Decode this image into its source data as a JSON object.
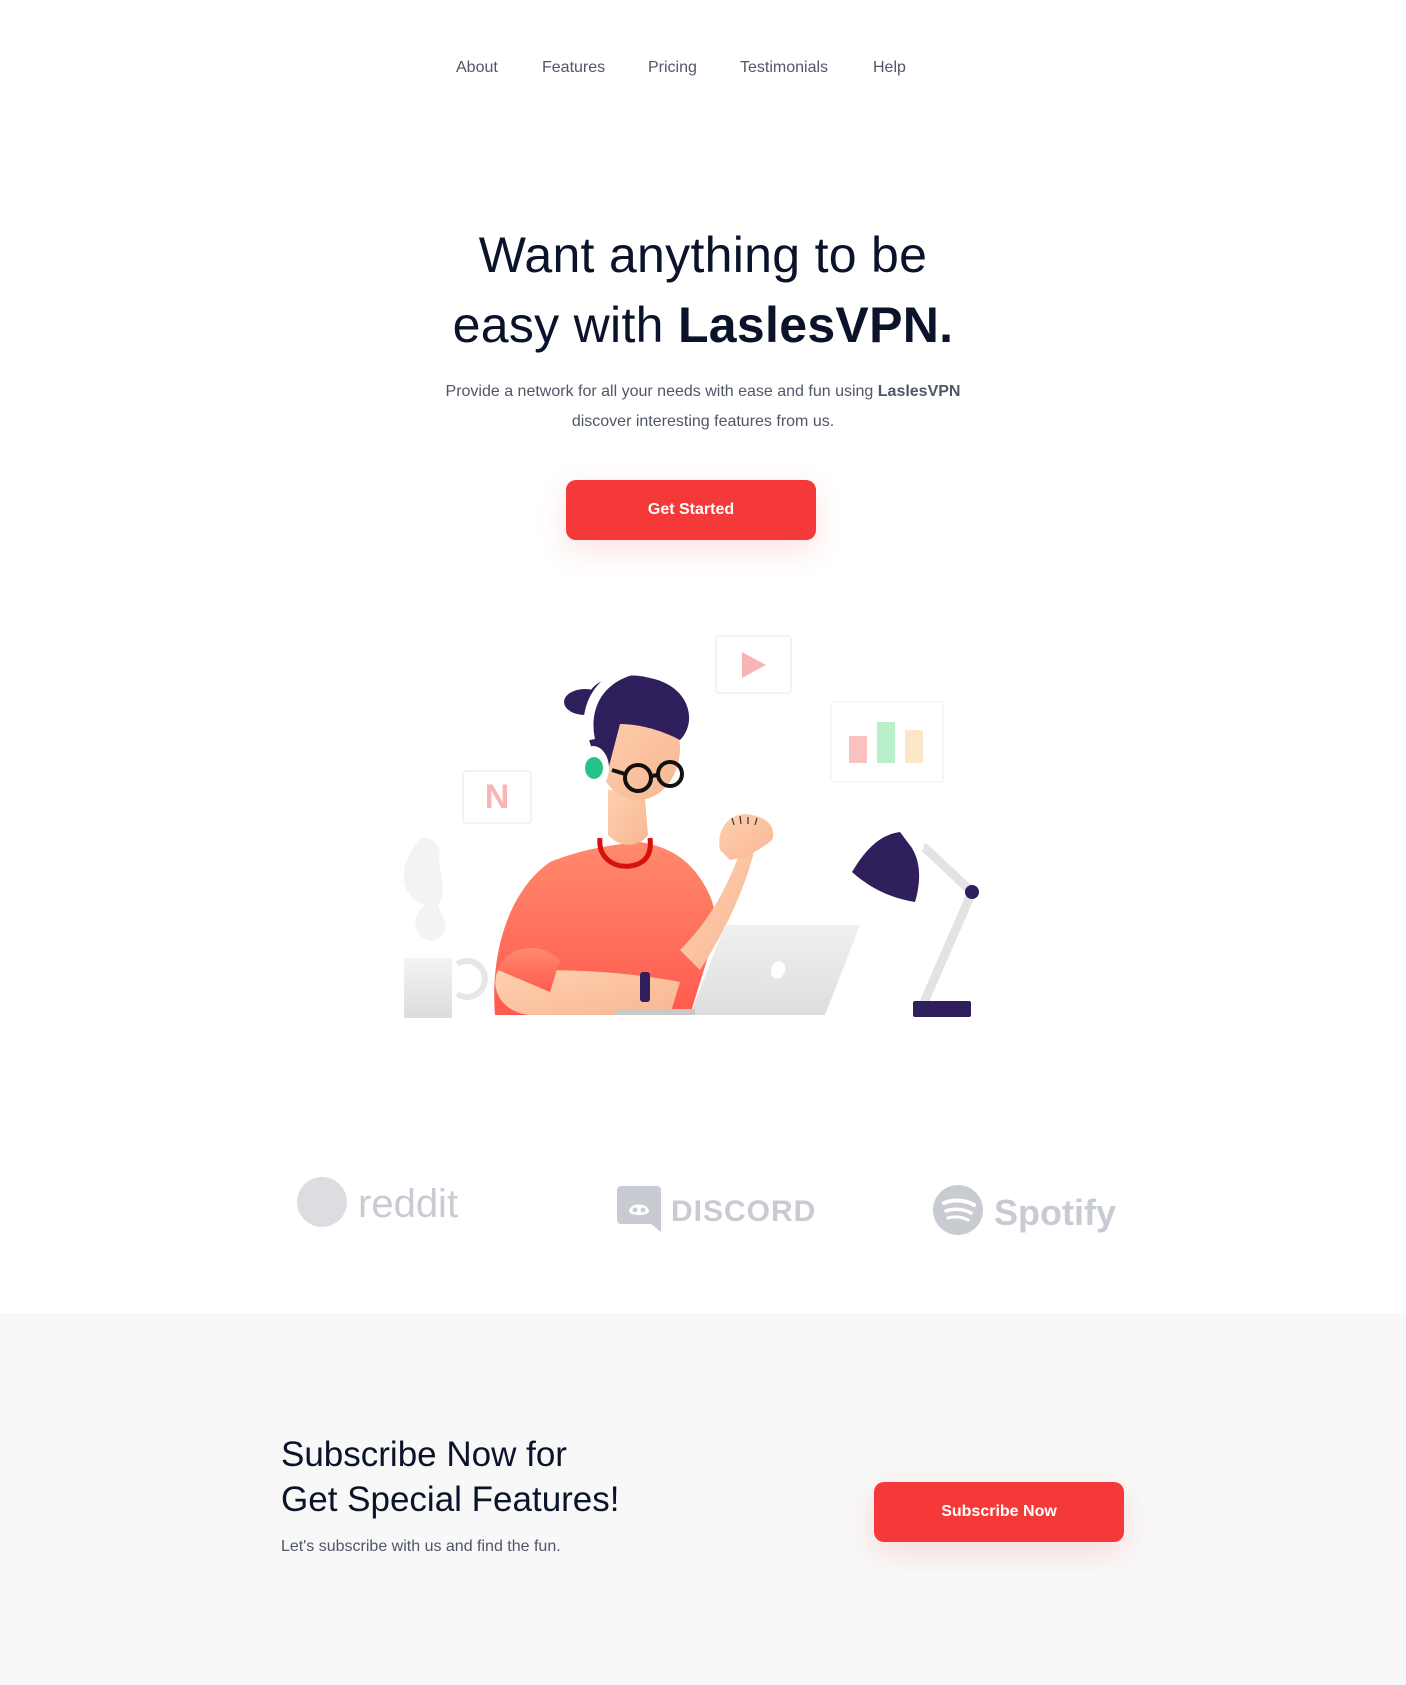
{
  "nav": {
    "items": [
      {
        "label": "About"
      },
      {
        "label": "Features"
      },
      {
        "label": "Pricing"
      },
      {
        "label": "Testimonials"
      },
      {
        "label": "Help"
      }
    ]
  },
  "hero": {
    "title_line1": "Want anything to be",
    "title_line2_prefix": "easy with ",
    "title_brand": "LaslesVPN.",
    "desc_prefix": "Provide a network for all your needs with ease and fun using ",
    "desc_brand": "LaslesVPN",
    "desc_suffix": "discover interesting features from us.",
    "cta_label": "Get Started",
    "illustration_tiles": {
      "netflix_letter": "N"
    }
  },
  "brands": [
    {
      "name": "reddit",
      "icon": "reddit-icon"
    },
    {
      "name": "DISCORD",
      "icon": "discord-icon"
    },
    {
      "name": "Spotify",
      "icon": "spotify-icon"
    }
  ],
  "subscribe": {
    "title_line1": "Subscribe Now for",
    "title_line2": "Get Special Features!",
    "desc": "Let's subscribe with us and find the fun.",
    "button_label": "Subscribe Now"
  },
  "colors": {
    "accent": "#f53838",
    "heading": "#0b132a",
    "body_text": "#4f5665",
    "subscribe_bg": "#f8f8f8",
    "brand_gray": "#c8cbd1"
  }
}
